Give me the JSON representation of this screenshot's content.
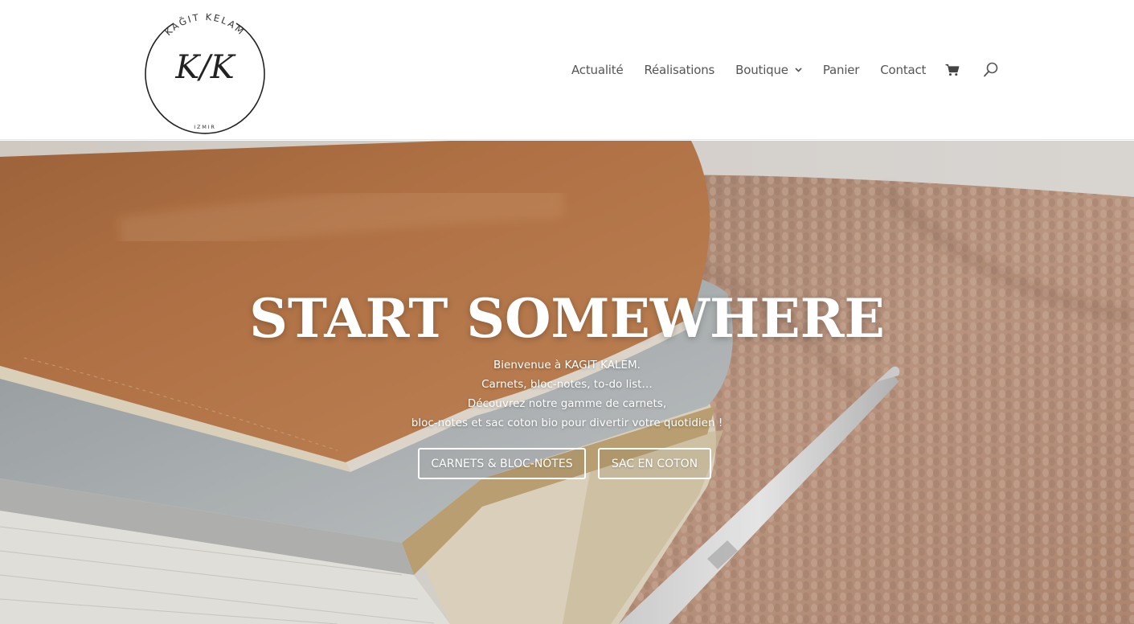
{
  "header": {
    "logo": {
      "top_text": "KAĞIT KELAM",
      "monogram": "K/K",
      "bottom_text": "IZMIR"
    },
    "nav": [
      {
        "label": "Actualité"
      },
      {
        "label": "Réalisations"
      },
      {
        "label": "Boutique"
      },
      {
        "label": "Panier"
      },
      {
        "label": "Contact"
      }
    ],
    "icons": {
      "cart": "shopping-cart-icon",
      "search": "search-icon",
      "dropdown": "chevron-down-icon"
    }
  },
  "hero": {
    "title": "START SOMEWHERE",
    "lines": [
      "Bienvenue à KAGIT KALEM.",
      "Carnets, bloc-notes, to-do list…",
      "Découvrez notre gamme de carnets,",
      "bloc-notes et sac coton bio pour divertir votre quotidien !"
    ],
    "buttons": [
      {
        "label": "CARNETS & BLOC-NOTES"
      },
      {
        "label": "SAC EN COTON"
      }
    ]
  },
  "colors": {
    "nav_text": "#555555",
    "hero_text": "#ffffff",
    "notebook_leather": "#b57443",
    "knit": "#c49c85"
  }
}
